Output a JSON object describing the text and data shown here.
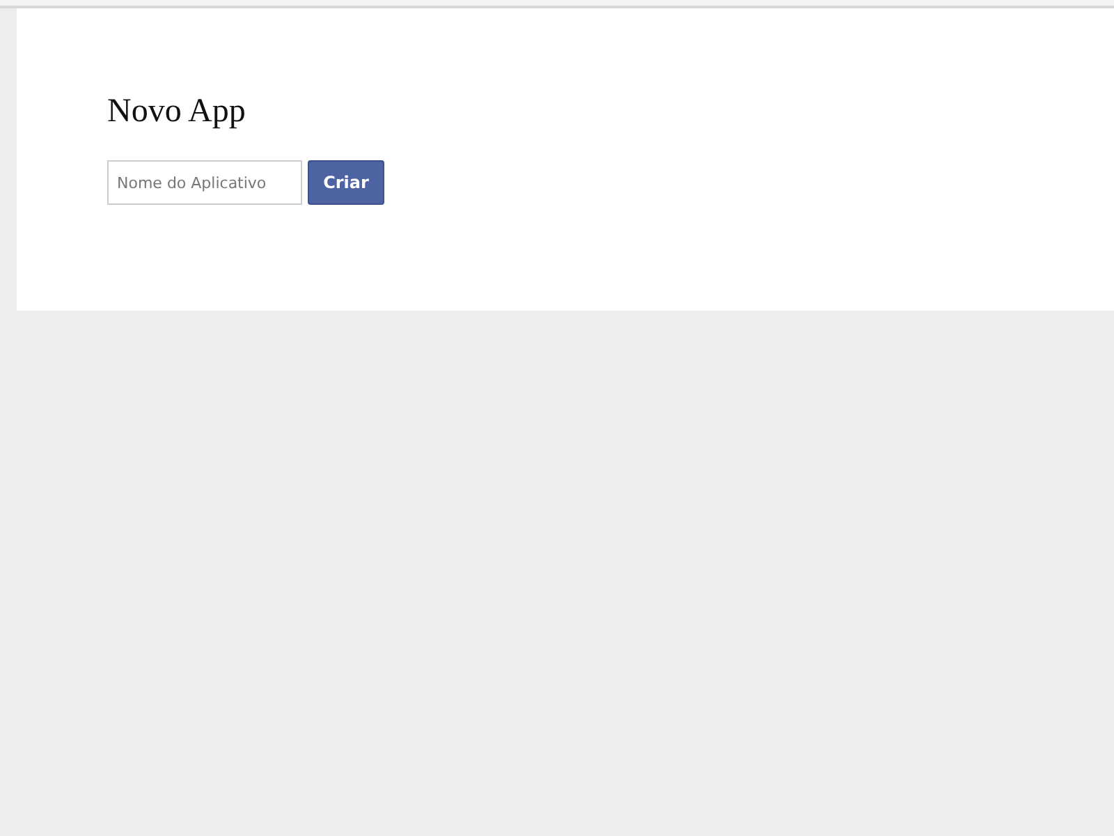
{
  "title": "Novo App",
  "form": {
    "placeholder": "Nome do Aplicativo",
    "button": "Criar"
  }
}
